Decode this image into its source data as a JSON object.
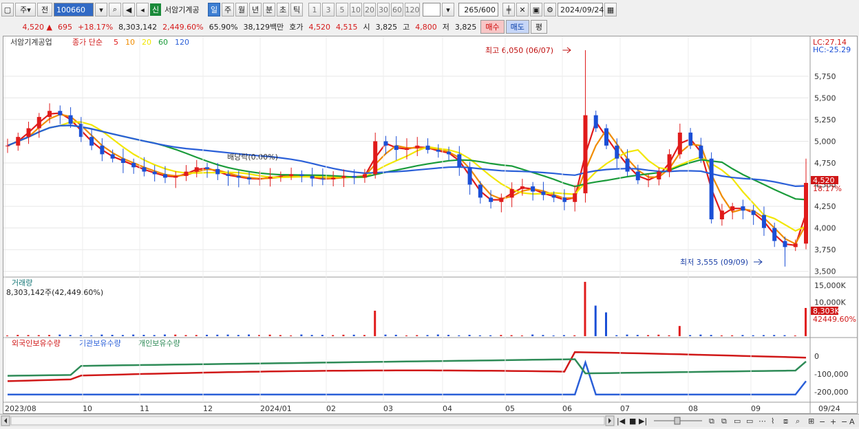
{
  "toolbar": {
    "period_label": "주",
    "prev_label": "전",
    "code": "100660",
    "new_badge": "신",
    "stock_name": "서암기계공",
    "period_buttons": [
      "일",
      "주",
      "월",
      "년",
      "분",
      "초",
      "틱"
    ],
    "active_period": "일",
    "minute_buttons": [
      "1",
      "3",
      "5",
      "10",
      "20",
      "30",
      "60",
      "120"
    ],
    "count": "265",
    "count_total": "/600",
    "date": "2024/09/24"
  },
  "quote": {
    "price": "4,520",
    "change": "695",
    "change_pct": "+18.17%",
    "volume": "8,303,142",
    "volume_pct": "2,449.60%",
    "turnover": "65.90%",
    "amount": "38,129백만",
    "ask_label": "호가",
    "ask": "4,520",
    "bid": "4,515",
    "open_label": "시",
    "open": "3,825",
    "high_label": "고",
    "high": "4,800",
    "low_label": "저",
    "low": "3,825",
    "buy_label": "매수",
    "sell_label": "매도",
    "eval_label": "평"
  },
  "price_panel": {
    "title": "서암기계공업",
    "ma_label": "종가 단순",
    "ma_periods": [
      "5",
      "10",
      "20",
      "60",
      "120"
    ],
    "ma_colors": [
      "#e01b1b",
      "#f08c00",
      "#f2e600",
      "#1a9b3a",
      "#2a5fd8"
    ],
    "lc": "LC:27.14",
    "hc": "HC:-25.29",
    "high_note": "최고 6,050 (06/07)",
    "low_note": "최저 3,555 (09/09)",
    "dividend_note": "배당락(0.00%)",
    "current_tag": "4,520",
    "current_pct": "18.17%",
    "y_ticks": [
      "5,750",
      "5,500",
      "5,250",
      "5,000",
      "4,750",
      "4,500",
      "4,250",
      "4,000",
      "3,750",
      "3,500"
    ]
  },
  "volume_panel": {
    "title": "거래량",
    "value": "8,303,142주(42,449.60%)",
    "y_ticks": [
      "15,000K",
      "10,000K"
    ],
    "current_tag": "8,303K",
    "current_pct": "42449.60%"
  },
  "holding_panel": {
    "series": [
      "외국인보유수량",
      "기관보유수량",
      "개인보유수량"
    ],
    "series_colors": [
      "#d01818",
      "#2a5fd8",
      "#2e8b57"
    ],
    "y_ticks": [
      "0",
      "-100,000",
      "-200,000"
    ]
  },
  "x_axis": [
    "2023/08",
    "10",
    "11",
    "12",
    "2024/01",
    "02",
    "03",
    "04",
    "05",
    "06",
    "07",
    "08",
    "09",
    "09/24"
  ],
  "chart_data": {
    "type": "candlestick",
    "title": "서암기계공업",
    "x_range": [
      "2023/08",
      "2024/09/24"
    ],
    "y_range": [
      3450,
      6050
    ],
    "series": [
      {
        "name": "5",
        "type": "line",
        "color": "#e01b1b"
      },
      {
        "name": "10",
        "type": "line",
        "color": "#f08c00"
      },
      {
        "name": "20",
        "type": "line",
        "color": "#f2e600"
      },
      {
        "name": "60",
        "type": "line",
        "color": "#1a9b3a"
      },
      {
        "name": "120",
        "type": "line",
        "color": "#2a5fd8"
      }
    ],
    "close_path": [
      4950,
      5050,
      5150,
      5280,
      5350,
      5300,
      5200,
      5050,
      4950,
      4850,
      4800,
      4750,
      4700,
      4650,
      4620,
      4580,
      4600,
      4650,
      4700,
      4680,
      4620,
      4600,
      4580,
      4560,
      4570,
      4590,
      4600,
      4620,
      4600,
      4570,
      4560,
      4580,
      4600,
      4580,
      4620,
      5000,
      4950,
      4900,
      4920,
      4950,
      4900,
      4880,
      4850,
      4700,
      4500,
      4350,
      4300,
      4350,
      4450,
      4480,
      4420,
      4380,
      4350,
      4300,
      4400,
      5300,
      5150,
      4950,
      4800,
      4650,
      4550,
      4560,
      4650,
      4850,
      5100,
      4950,
      4800,
      4100,
      4200,
      4250,
      4200,
      4150,
      4000,
      3850,
      3780,
      3820,
      4520
    ],
    "high": {
      "value": 6050,
      "date": "06/07"
    },
    "low": {
      "value": 3555,
      "date": "09/09"
    },
    "last": {
      "close": 4520,
      "change_pct": 18.17,
      "open": 3825,
      "high": 4800,
      "low": 3825
    }
  }
}
